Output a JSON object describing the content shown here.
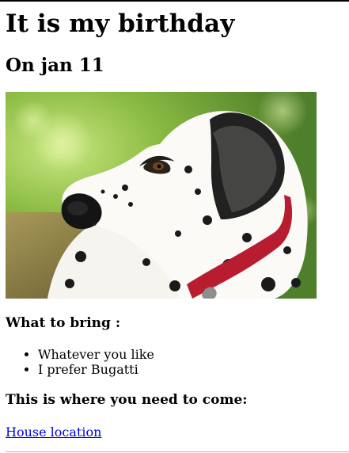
{
  "page": {
    "title": "It is my birthday",
    "subtitle": "On jan 11"
  },
  "image": {
    "icon": "dalmatian-photo"
  },
  "bring_section": {
    "heading": "What to bring :",
    "items": [
      "Whatever you like",
      "I prefer Bugatti"
    ]
  },
  "location_section": {
    "heading": "This is where you need to come:",
    "link_text": "House location"
  },
  "colors": {
    "link": "#0000ee",
    "text": "#000000",
    "background": "#ffffff"
  }
}
